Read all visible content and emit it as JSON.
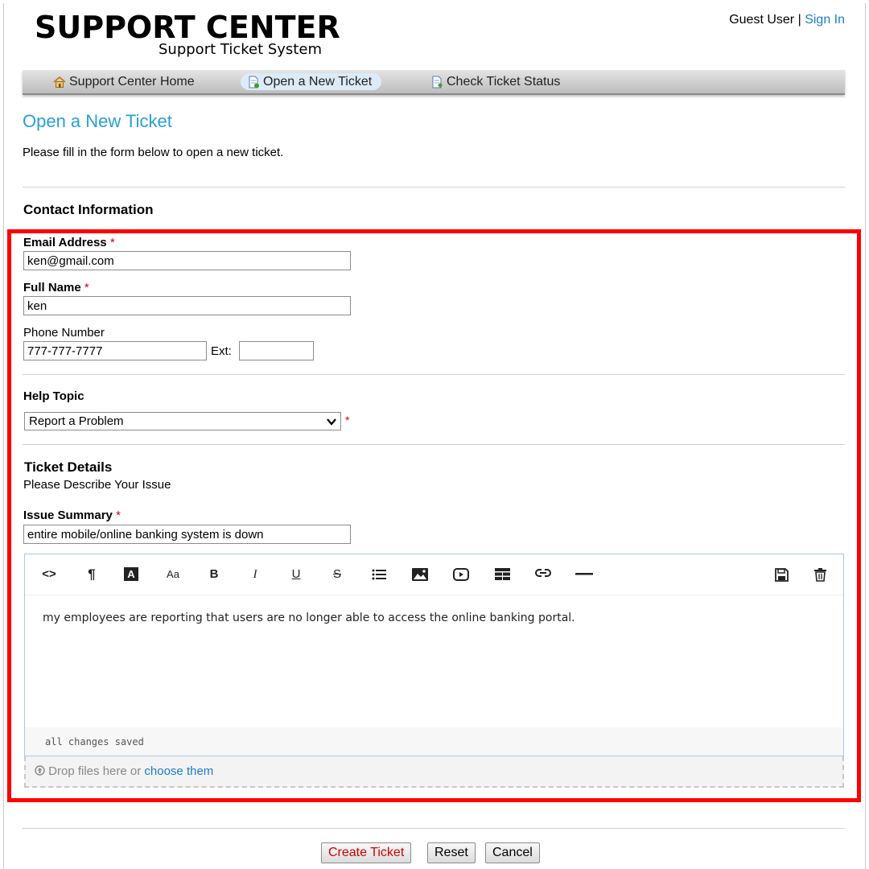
{
  "header": {
    "logo_title": "SUPPORT CENTER",
    "logo_subtitle": "Support Ticket System",
    "user": "Guest User",
    "separator": "|",
    "sign_in": "Sign In"
  },
  "nav": {
    "items": [
      {
        "label": "Support Center Home",
        "icon": "home-icon",
        "active": false
      },
      {
        "label": "Open a New Ticket",
        "icon": "new-ticket-icon",
        "active": true
      },
      {
        "label": "Check Ticket Status",
        "icon": "ticket-status-icon",
        "active": false
      }
    ]
  },
  "page": {
    "title": "Open a New Ticket",
    "intro": "Please fill in the form below to open a new ticket."
  },
  "contact": {
    "heading": "Contact Information",
    "required_mark": "*",
    "email_label": "Email Address",
    "email_value": "ken@gmail.com",
    "name_label": "Full Name",
    "name_value": "ken",
    "phone_label": "Phone Number",
    "phone_value": "777-777-7777",
    "ext_label": "Ext:",
    "ext_value": ""
  },
  "help": {
    "heading": "Help Topic",
    "selected": "Report a Problem"
  },
  "details": {
    "heading": "Ticket Details",
    "subheading": "Please Describe Your Issue",
    "summary_label": "Issue Summary",
    "summary_value": "entire mobile/online banking system is down"
  },
  "editor": {
    "toolbar": {
      "html": "<>",
      "paragraph": "¶",
      "font_color": "A",
      "font_size": "Aa",
      "bold": "B",
      "italic": "I",
      "underline": "U",
      "strike": "S"
    },
    "body": "my employees are reporting that users are no longer able to access the online banking portal.",
    "status": "all changes saved"
  },
  "dropzone": {
    "text": "Drop files here or",
    "link": "choose them"
  },
  "buttons": {
    "create": "Create Ticket",
    "reset": "Reset",
    "cancel": "Cancel"
  },
  "colors": {
    "link": "#1a7ec3",
    "title": "#2a9fd6",
    "highlight_box": "#ff0000",
    "create_text": "#d00000"
  }
}
